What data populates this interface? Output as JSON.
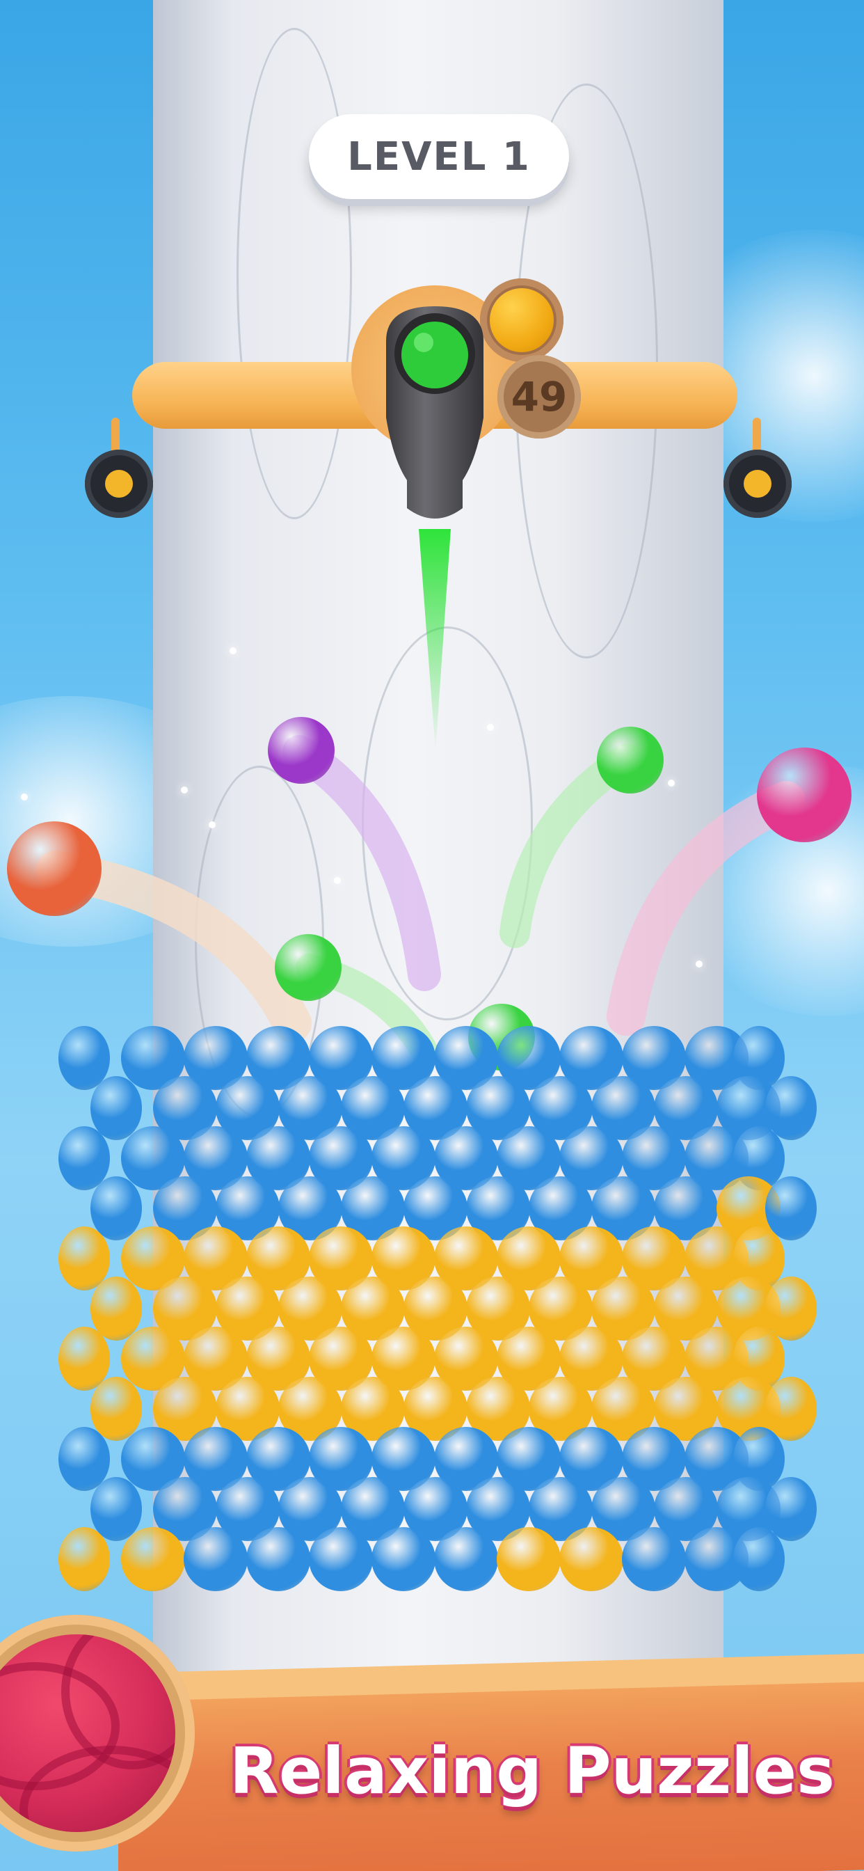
{
  "hud": {
    "level_label": "LEVEL 1",
    "ammo_count": "49",
    "next_ball_color": "#f2aa14",
    "loaded_ball_color": "#2ecc3a"
  },
  "tower": {
    "layers": [
      "blue",
      "blue",
      "blue",
      "blue",
      "yellow",
      "yellow",
      "yellow",
      "yellow",
      "blue",
      "blue",
      "mixed"
    ],
    "colors": {
      "blue": "#2f8ee0",
      "yellow": "#f4b41c"
    }
  },
  "flying_balls": [
    {
      "color": "purple",
      "hex": "#9b38c9"
    },
    {
      "color": "green",
      "hex": "#39d341"
    },
    {
      "color": "pink",
      "hex": "#e2378d"
    },
    {
      "color": "orange",
      "hex": "#e8623a"
    },
    {
      "color": "green",
      "hex": "#39d341"
    },
    {
      "color": "green",
      "hex": "#39d341"
    }
  ],
  "banner": {
    "tagline": "Relaxing Puzzles",
    "accent": "#e2467a"
  }
}
